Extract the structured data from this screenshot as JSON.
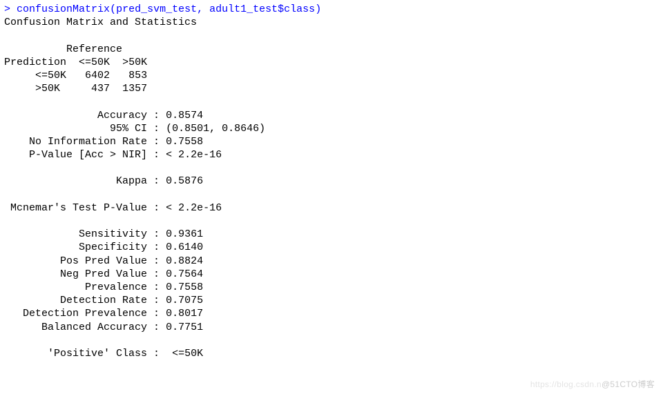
{
  "prompt": {
    "symbol": ">",
    "func": "confusionMatrix",
    "open": "(",
    "arg1": "pred_svm_test",
    "comma": ", ",
    "arg2a": "adult1_test",
    "dollar": "$",
    "arg2b": "class",
    "close": ")"
  },
  "header": "Confusion Matrix and Statistics",
  "matrix": {
    "ref_label": "Reference",
    "pred_label": "Prediction",
    "col1": "<=50K",
    "col2": ">50K",
    "rows": [
      {
        "name": "<=50K",
        "v1": "6402",
        "v2": "853"
      },
      {
        "name": ">50K",
        "v1": "437",
        "v2": "1357"
      }
    ]
  },
  "stats": {
    "accuracy_label": "Accuracy",
    "accuracy": "0.8574",
    "ci_label": "95% CI",
    "ci": "(0.8501, 0.8646)",
    "nir_label": "No Information Rate",
    "nir": "0.7558",
    "pval_acc_label": "P-Value [Acc > NIR]",
    "pval_acc": "< 2.2e-16",
    "kappa_label": "Kappa",
    "kappa": "0.5876",
    "mcnemar_label": "Mcnemar's Test P-Value",
    "mcnemar": "< 2.2e-16",
    "sensitivity_label": "Sensitivity",
    "sensitivity": "0.9361",
    "specificity_label": "Specificity",
    "specificity": "0.6140",
    "ppv_label": "Pos Pred Value",
    "ppv": "0.8824",
    "npv_label": "Neg Pred Value",
    "npv": "0.7564",
    "prevalence_label": "Prevalence",
    "prevalence": "0.7558",
    "detect_rate_label": "Detection Rate",
    "detect_rate": "0.7075",
    "detect_prev_label": "Detection Prevalence",
    "detect_prev": "0.8017",
    "bal_acc_label": "Balanced Accuracy",
    "bal_acc": "0.7751",
    "pos_class_label": "'Positive' Class",
    "pos_class": " <=50K"
  },
  "watermark": {
    "faint": "https://blog.csdn.n",
    "main": "@51CTO博客"
  }
}
